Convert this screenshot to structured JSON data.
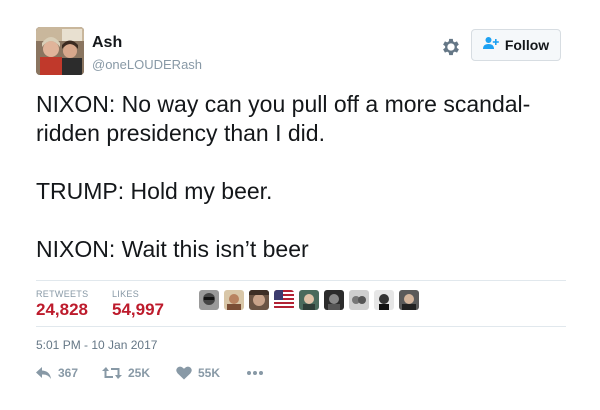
{
  "user": {
    "name": "Ash",
    "handle": "@oneLOUDERash"
  },
  "follow_button": {
    "label": "Follow"
  },
  "tweet": {
    "lines": [
      "NIXON: No way can you pull off a more scandal-",
      "ridden presidency than I did.",
      "TRUMP: Hold my beer.",
      "NIXON: Wait this isn’t beer"
    ]
  },
  "stats": {
    "retweets_label": "RETWEETS",
    "retweets_value": "24,828",
    "likes_label": "LIKES",
    "likes_value": "54,997"
  },
  "likers": [
    {
      "icon": "liker-avatar-1"
    },
    {
      "icon": "liker-avatar-2"
    },
    {
      "icon": "liker-avatar-3"
    },
    {
      "icon": "liker-avatar-flag"
    },
    {
      "icon": "liker-avatar-5"
    },
    {
      "icon": "liker-avatar-6"
    },
    {
      "icon": "liker-avatar-7"
    },
    {
      "icon": "liker-avatar-8"
    },
    {
      "icon": "liker-avatar-9"
    }
  ],
  "timestamp": "5:01 PM - 10 Jan 2017",
  "actions": {
    "reply_count": "367",
    "retweet_count": "25K",
    "like_count": "55K"
  },
  "colors": {
    "accent_red": "#bd1b2c",
    "muted_gray": "#8899a6",
    "text_dark": "#14171a",
    "follow_icon_blue": "#1da1f2"
  }
}
